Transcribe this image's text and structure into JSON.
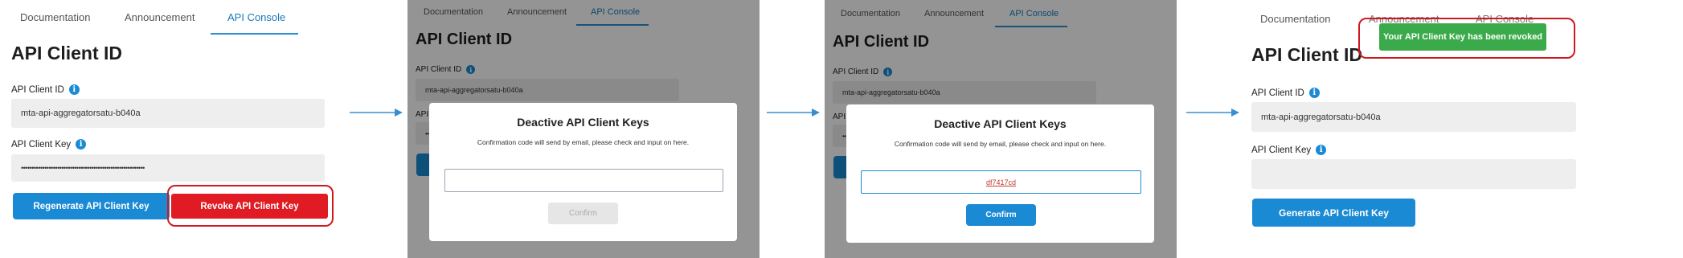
{
  "tabs": [
    "Documentation",
    "Announcement",
    "API Console"
  ],
  "page_title": "API Client ID",
  "client_id_label": "API Client ID",
  "client_key_label": "API Client Key",
  "client_id_value": "mta-api-aggregatorsatu-b040a",
  "client_key_masked": "••••••••••••••••••••••••••••••••••••••••••••••••••••••••••",
  "info_glyph": "i",
  "panel1": {
    "regenerate_button": "Regenerate API Client Key",
    "revoke_button": "Revoke API Client Key"
  },
  "modal": {
    "title": "Deactive API Client Keys",
    "message": "Confirmation code will send by email, please check and input on here.",
    "confirm_button": "Confirm",
    "input_value_empty": "",
    "input_value_filled": "df7417cd"
  },
  "panel4": {
    "toast": "Your API Client Key has been revoked",
    "client_key_value": "",
    "generate_button": "Generate API Client Key"
  },
  "colors": {
    "accent": "#1a8ad4",
    "danger": "#e01b24",
    "success": "#3aaa4a",
    "highlight_ring": "#d0191f"
  }
}
